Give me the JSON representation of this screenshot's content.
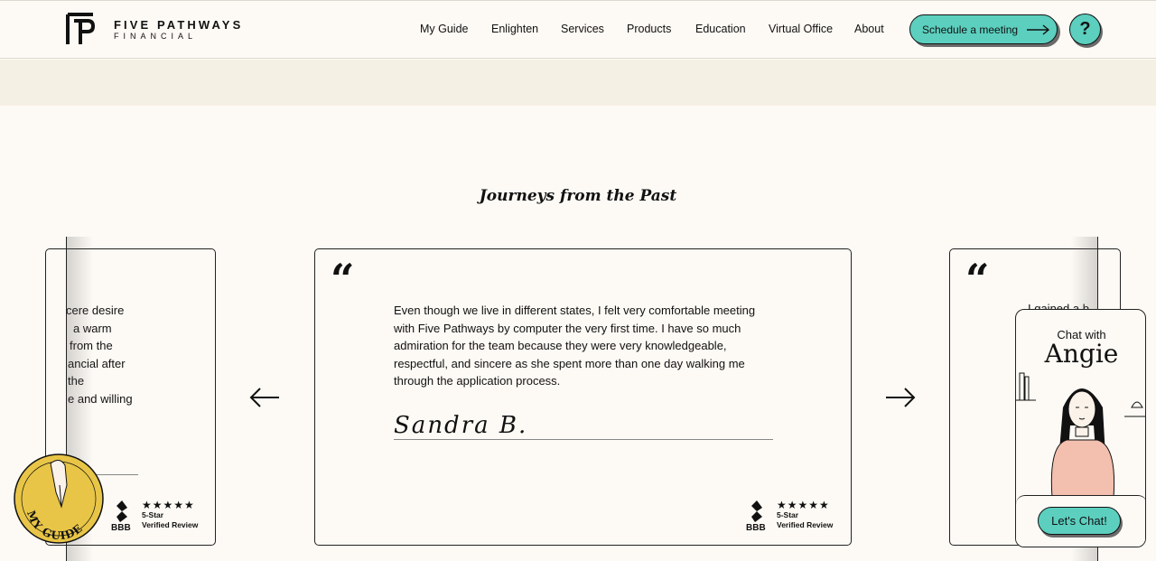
{
  "brand": {
    "name": "FIVE PATHWAYS",
    "sub": "FINANCIAL"
  },
  "nav": {
    "items": [
      {
        "label": "My Guide"
      },
      {
        "label": "Enlighten"
      },
      {
        "label": "Services"
      },
      {
        "label": "Products"
      },
      {
        "label": "Education"
      },
      {
        "label": "Virtual Office"
      },
      {
        "label": "About"
      }
    ],
    "cta_label": "Schedule a meeting",
    "help_label": "?"
  },
  "section": {
    "title": "Journeys from the Past"
  },
  "testimonials": {
    "left": {
      "lines": [
        "cere desire",
        "a warm",
        "from the",
        "ancial after",
        "the",
        "e and willing"
      ]
    },
    "main": {
      "text": "Even though we live in different states, I felt very comfortable meeting with Five Pathways by computer the very first time. I have so much admiration for the team because they were very knowledgeable, respectful, and sincere as she spent more than one day walking me through the application process.",
      "signature": "Sandra B."
    },
    "right": {
      "partial": "I gained a b"
    }
  },
  "bbb": {
    "logo_text": "BBB",
    "stars": "★★★★★",
    "line1": "5-Star",
    "line2": "Verified Review"
  },
  "chat": {
    "with": "Chat with",
    "name": "Angie",
    "button": "Let's Chat!"
  },
  "guide_badge": {
    "label": "MY GUIDE"
  },
  "colors": {
    "accent": "#5ccfbf",
    "background": "#fdfaf5",
    "band": "#f5f0e4"
  }
}
